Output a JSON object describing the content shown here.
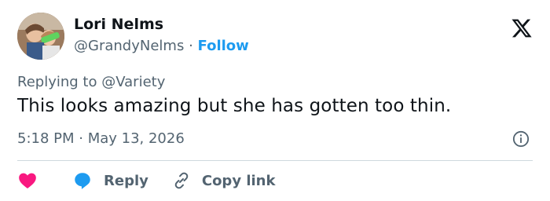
{
  "author": {
    "name": "Lori Nelms",
    "handle": "@GrandyNelms",
    "separator": "·",
    "follow_label": "Follow"
  },
  "reply_context": {
    "prefix": "Replying to",
    "mention": "@Variety"
  },
  "tweet": {
    "text": "This looks amazing but she has gotten too thin.",
    "timestamp": "5:18 PM · May 13, 2026"
  },
  "actions": {
    "reply_label": "Reply",
    "copy_link_label": "Copy link"
  },
  "colors": {
    "accent": "#1d9bf0",
    "like": "#f91880",
    "muted": "#536471",
    "text": "#0f1419",
    "divider": "#cfd9de"
  },
  "icons": [
    "x-logo-icon",
    "info-icon",
    "heart-icon",
    "reply-bubble-icon",
    "link-icon"
  ]
}
